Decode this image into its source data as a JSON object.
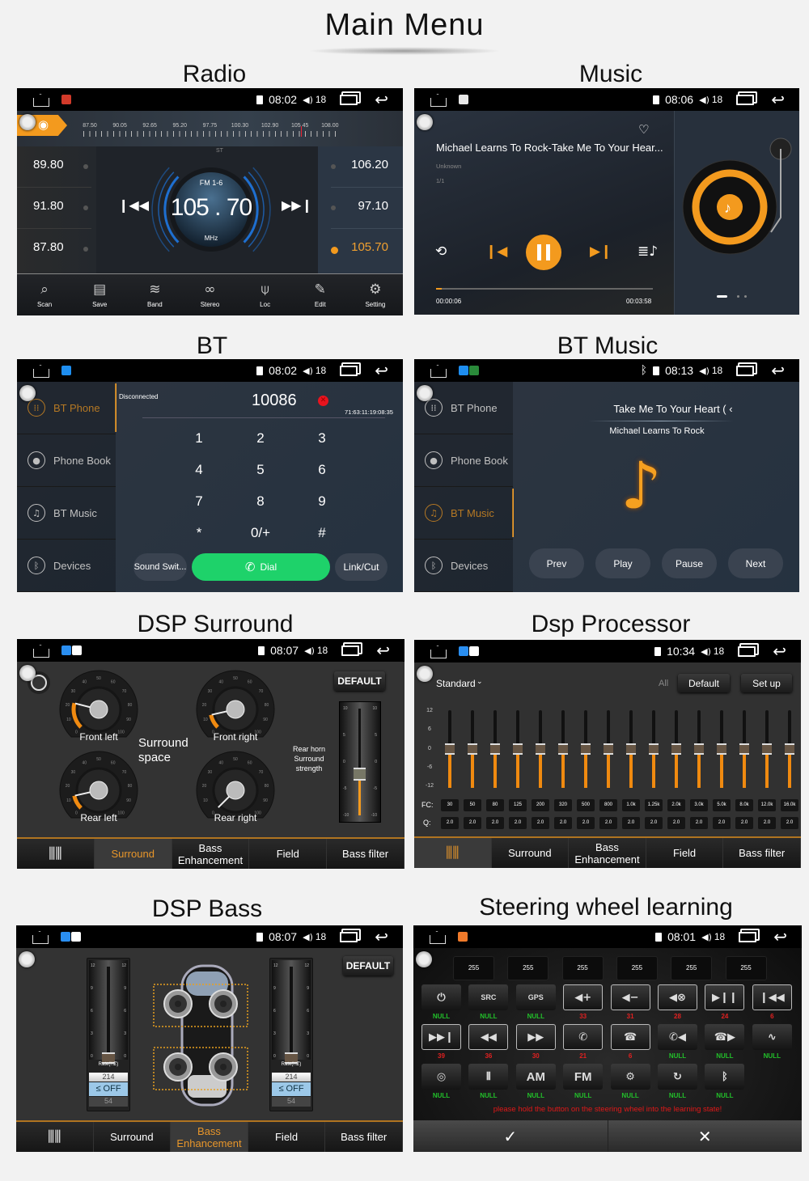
{
  "page_title": "Main Menu",
  "colors": {
    "accent": "#f0901e",
    "dial_green": "#1ed26a",
    "null_green": "#22c02a",
    "learned_red": "#e02020",
    "error_red": "#e8141e"
  },
  "panels": {
    "radio": {
      "title": "Radio",
      "status": {
        "time": "08:02",
        "volume": "18",
        "apps": [
          {
            "icon": "radio-app-icon",
            "color": "#d23a2a"
          }
        ]
      },
      "scale_labels": [
        "87.50",
        "90.05",
        "92.65",
        "95.20",
        "97.75",
        "100.30",
        "102.90",
        "105.45",
        "108.00"
      ],
      "presets_left": [
        "89.80",
        "91.80",
        "87.80"
      ],
      "presets_right": [
        "106.20",
        "97.10",
        "105.70"
      ],
      "active_preset": "105.70",
      "stereo": "ST",
      "band": "FM 1-6",
      "frequency": "105 . 70",
      "unit": "MHz",
      "toolbar": [
        {
          "label": "Scan",
          "icon": "scan-icon"
        },
        {
          "label": "Save",
          "icon": "save-icon"
        },
        {
          "label": "Band",
          "icon": "band-icon"
        },
        {
          "label": "Stereo",
          "icon": "stereo-icon"
        },
        {
          "label": "Loc",
          "icon": "antenna-icon"
        },
        {
          "label": "Edit",
          "icon": "edit-icon"
        },
        {
          "label": "Setting",
          "icon": "gear-icon"
        }
      ]
    },
    "music": {
      "title": "Music",
      "status": {
        "time": "08:06",
        "volume": "18",
        "apps": [
          {
            "icon": "music-app-icon",
            "color": "#e8e8e8"
          }
        ]
      },
      "song": "Michael Learns To Rock-Take Me To Your Hear...",
      "artist": "Unknown",
      "track": "1/1",
      "elapsed": "00:00:06",
      "duration": "00:03:58",
      "progress": 0.025,
      "page_dots": 3,
      "active_page": 0
    },
    "bt": {
      "title": "BT",
      "status": {
        "time": "08:02",
        "volume": "18",
        "apps": [
          {
            "icon": "bt-app-icon",
            "color": "#1e8ef0"
          }
        ]
      },
      "sidebar": [
        {
          "label": "BT Phone",
          "icon": "dialpad-icon",
          "active": true
        },
        {
          "label": "Phone Book",
          "icon": "contact-icon",
          "active": false
        },
        {
          "label": "BT Music",
          "icon": "music-note-icon",
          "active": false
        },
        {
          "label": "Devices",
          "icon": "bluetooth-icon",
          "active": false
        }
      ],
      "connection": "Disconnected",
      "number": "10086",
      "mac": "71:63:11:19:08:35",
      "keys": [
        "1",
        "2",
        "3",
        "4",
        "5",
        "6",
        "7",
        "8",
        "9",
        "*",
        "0/+",
        "#"
      ],
      "sound_switch": "Sound Swit...",
      "dial": "Dial",
      "link_cut": "Link/Cut"
    },
    "bt_music": {
      "title": "BT Music",
      "status": {
        "time": "08:13",
        "volume": "18",
        "bluetooth": true,
        "apps": [
          {
            "icon": "bt-app-icon",
            "color": "#1e8ef0"
          },
          {
            "icon": "shield-app-icon",
            "color": "#2a8a3a"
          }
        ]
      },
      "sidebar": [
        {
          "label": "BT Phone",
          "icon": "dialpad-icon",
          "active": false
        },
        {
          "label": "Phone Book",
          "icon": "contact-icon",
          "active": false
        },
        {
          "label": "BT Music",
          "icon": "music-note-icon",
          "active": true
        },
        {
          "label": "Devices",
          "icon": "bluetooth-icon",
          "active": false
        }
      ],
      "song": "Take Me To Your Heart ( ‹",
      "artist": "Michael Learns To Rock",
      "controls": [
        "Prev",
        "Play",
        "Pause",
        "Next"
      ]
    },
    "dsp_surround": {
      "title": "DSP Surround",
      "status": {
        "time": "08:07",
        "volume": "18",
        "apps": [
          {
            "icon": "dsp-app-icon",
            "color": "#2a8ef0"
          },
          {
            "icon": "settings-app-icon",
            "color": "#ffffff"
          }
        ]
      },
      "gauge_ticks": [
        "0",
        "10",
        "20",
        "30",
        "40",
        "50",
        "60",
        "70",
        "80",
        "90",
        "100"
      ],
      "gauges": [
        {
          "label": "Front left",
          "value": 22
        },
        {
          "label": "Front right",
          "value": 12
        },
        {
          "label": "Rear left",
          "value": 12
        },
        {
          "label": "Rear right",
          "value": 0
        }
      ],
      "surround_label": "Surround space",
      "default": "DEFAULT",
      "strength_label": [
        "Rear horn",
        "Surround",
        "strength"
      ],
      "strength_ticks": [
        "10",
        "5",
        "0",
        "-5",
        "-10"
      ],
      "strength_value": -2,
      "tabs": [
        "",
        "Surround",
        "Bass Enhancement",
        "Field",
        "Bass filter"
      ],
      "active_tab": 1
    },
    "dsp_processor": {
      "title": "Dsp Processor",
      "status": {
        "time": "10:34",
        "volume": "18",
        "apps": [
          {
            "icon": "dsp-app-icon",
            "color": "#2a8ef0"
          },
          {
            "icon": "settings-app-icon",
            "color": "#ffffff"
          }
        ]
      },
      "preset": "Standard",
      "all": "All",
      "default": "Default",
      "setup": "Set up",
      "scale": [
        "12",
        "6",
        "0",
        "-6",
        "-12"
      ],
      "fc_label": "FC:",
      "q_label": "Q:",
      "fc": [
        "30",
        "50",
        "80",
        "125",
        "200",
        "320",
        "500",
        "800",
        "1.0k",
        "1.25k",
        "2.0k",
        "3.0k",
        "5.0k",
        "8.0k",
        "12.0k",
        "16.0k"
      ],
      "q": [
        "2.0",
        "2.0",
        "2.0",
        "2.0",
        "2.0",
        "2.0",
        "2.0",
        "2.0",
        "2.0",
        "2.0",
        "2.0",
        "2.0",
        "2.0",
        "2.0",
        "2.0",
        "2.0"
      ],
      "gains": [
        0,
        0,
        0,
        0,
        0,
        0,
        0,
        0,
        0,
        0,
        0,
        0,
        0,
        0,
        0,
        0
      ],
      "tabs": [
        "",
        "Surround",
        "Bass Enhancement",
        "Field",
        "Bass filter"
      ],
      "active_tab": 0
    },
    "dsp_bass": {
      "title": "DSP Bass",
      "status": {
        "time": "08:07",
        "volume": "18",
        "apps": [
          {
            "icon": "dsp-app-icon",
            "color": "#2a8ef0"
          },
          {
            "icon": "settings-app-icon",
            "color": "#ffffff"
          }
        ]
      },
      "default": "DEFAULT",
      "slider_ticks": [
        "12",
        "9",
        "6",
        "3",
        "0"
      ],
      "rate_label": "Rate(HZ)",
      "left": {
        "value": 0,
        "rate_above": "214",
        "rate": "≤ OFF",
        "rate_below": "54"
      },
      "right": {
        "value": 0,
        "rate_above": "214",
        "rate": "≤ OFF",
        "rate_below": "54"
      },
      "tabs": [
        "",
        "Surround",
        "Bass Enhancement",
        "Field",
        "Bass filter"
      ],
      "active_tab": 2
    },
    "steering": {
      "title": "Steering wheel learning",
      "status": {
        "time": "08:01",
        "volume": "18",
        "apps": [
          {
            "icon": "steering-app-icon",
            "color": "#f07a2a"
          }
        ]
      },
      "codes": [
        "255",
        "255",
        "255",
        "255",
        "255",
        "255"
      ],
      "buttons": [
        {
          "icon": "power-icon",
          "text": "",
          "value": "NULL"
        },
        {
          "icon": "src-icon",
          "text": "SRC",
          "value": "NULL"
        },
        {
          "icon": "gps-icon",
          "text": "GPS",
          "value": "NULL"
        },
        {
          "icon": "volume-up-icon",
          "text": "",
          "value": "33"
        },
        {
          "icon": "volume-down-icon",
          "text": "",
          "value": "31"
        },
        {
          "icon": "mute-icon",
          "text": "",
          "value": "28"
        },
        {
          "icon": "play-pause-icon",
          "text": "",
          "value": "24"
        },
        {
          "icon": "previous-icon",
          "text": "",
          "value": "6"
        },
        {
          "icon": "next-icon",
          "text": "",
          "value": "39"
        },
        {
          "icon": "rewind-icon",
          "text": "",
          "value": "36"
        },
        {
          "icon": "fast-forward-icon",
          "text": "",
          "value": "30"
        },
        {
          "icon": "phone-answer-icon",
          "text": "",
          "value": "21"
        },
        {
          "icon": "phone-hangup-icon",
          "text": "",
          "value": "6"
        },
        {
          "icon": "answer-previous-icon",
          "text": "",
          "value": "NULL"
        },
        {
          "icon": "hangup-next-icon",
          "text": "",
          "value": "NULL"
        },
        {
          "icon": "voice-icon",
          "text": "",
          "value": "NULL"
        },
        {
          "icon": "camera-icon",
          "text": "",
          "value": "NULL"
        },
        {
          "icon": "av-input-icon",
          "text": "",
          "value": "NULL"
        },
        {
          "icon": "am-icon",
          "text": "AM",
          "value": "NULL"
        },
        {
          "icon": "fm-icon",
          "text": "FM",
          "value": "NULL"
        },
        {
          "icon": "settings-icon",
          "text": "",
          "value": "NULL"
        },
        {
          "icon": "360-view-icon",
          "text": "",
          "value": "NULL"
        },
        {
          "icon": "bluetooth-icon",
          "text": "",
          "value": "NULL"
        }
      ],
      "message": "please hold the button on the steering wheel into the learning state!"
    }
  }
}
